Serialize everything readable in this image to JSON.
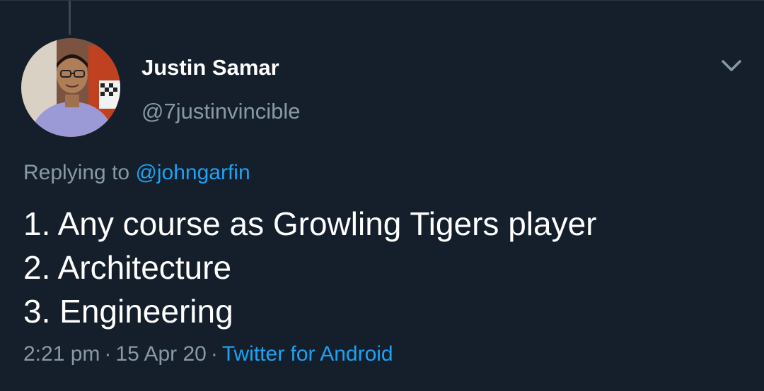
{
  "author": {
    "display_name": "Justin Samar",
    "handle": "@7justinvincible"
  },
  "reply": {
    "prefix": "Replying to",
    "mention": "@johngarfin"
  },
  "tweet": {
    "lines": [
      "1. Any course as Growling Tigers player",
      "2. Architecture",
      "3. Engineering"
    ]
  },
  "meta": {
    "time": "2:21 pm",
    "separator": "·",
    "date": "15 Apr 20",
    "source": "Twitter for Android"
  },
  "icons": {
    "menu": "chevron-down-icon"
  },
  "colors": {
    "background": "#151f2b",
    "text": "#ffffff",
    "secondary": "#8899a6",
    "link": "#1da1f2"
  }
}
